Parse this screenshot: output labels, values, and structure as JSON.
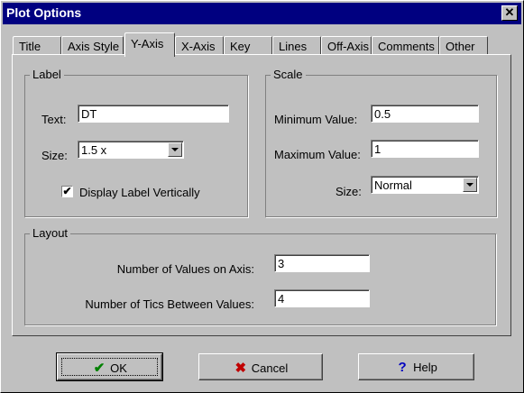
{
  "window": {
    "title": "Plot Options",
    "close_label": "✕"
  },
  "tabs": [
    {
      "label": "Title"
    },
    {
      "label": "Axis Style"
    },
    {
      "label": "Y-Axis"
    },
    {
      "label": "X-Axis"
    },
    {
      "label": "Key"
    },
    {
      "label": "Lines"
    },
    {
      "label": "Off-Axis"
    },
    {
      "label": "Comments"
    },
    {
      "label": "Other"
    }
  ],
  "active_tab": "Y-Axis",
  "label_group": {
    "legend": "Label",
    "text_label": "Text:",
    "text_value": "DT",
    "size_label": "Size:",
    "size_value": "1.5 x",
    "vertical_checkbox_label": "Display Label Vertically",
    "vertical_checked": true,
    "check_mark": "✔"
  },
  "scale_group": {
    "legend": "Scale",
    "min_label": "Minimum Value:",
    "min_value": "0.5",
    "max_label": "Maximum Value:",
    "max_value": "1",
    "size_label": "Size:",
    "size_value": "Normal"
  },
  "layout_group": {
    "legend": "Layout",
    "values_label": "Number of Values on Axis:",
    "values_value": "3",
    "tics_label": "Number of Tics Between Values:",
    "tics_value": "4"
  },
  "buttons": {
    "ok": "OK",
    "cancel": "Cancel",
    "help": "Help",
    "ok_icon": "✔",
    "cancel_icon": "✖",
    "help_icon": "?"
  },
  "colors": {
    "titlebar": "#000080",
    "ok_icon": "#008000",
    "cancel_icon": "#c00000",
    "help_icon": "#0000c0"
  }
}
